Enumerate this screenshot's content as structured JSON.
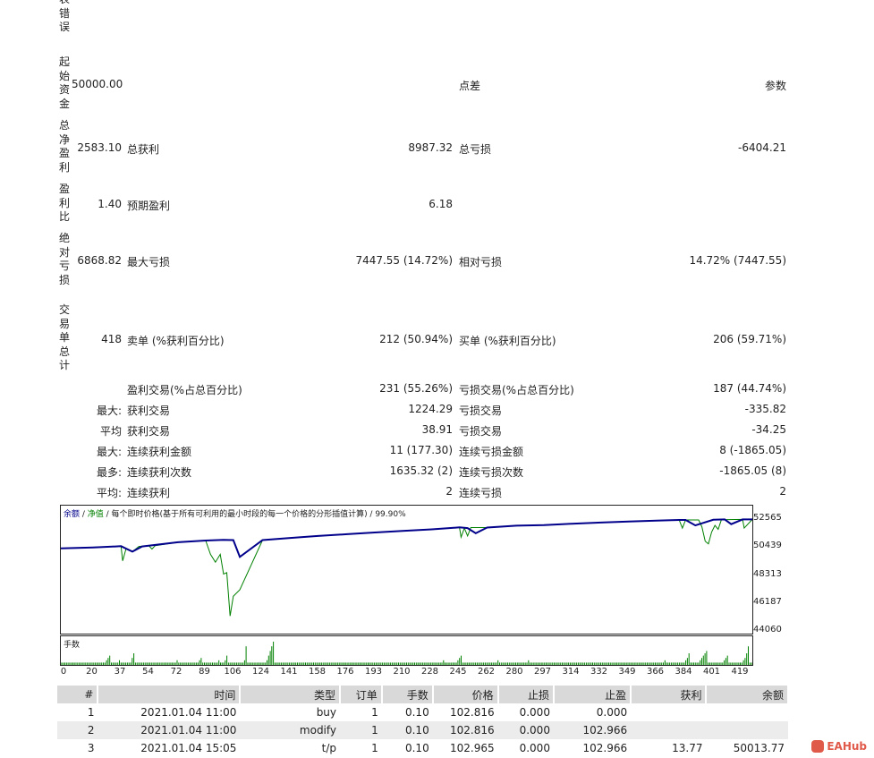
{
  "vlabels": {
    "top": "表错误",
    "initial_deposit": "起始资金",
    "total_net_profit": "总净盈利",
    "profit_factor": "盈利比",
    "abs_drawdown": "绝对亏损",
    "total_trades": "交易单总计"
  },
  "rows": {
    "r1": {
      "v1": "50000.00",
      "l2": "点差",
      "l3": "参数"
    },
    "r2": {
      "v1": "2583.10",
      "l2": "总获利",
      "v2": "8987.32",
      "l3": "总亏损",
      "v3": "-6404.21"
    },
    "r3": {
      "v1": "1.40",
      "l2": "预期盈利",
      "v2": "6.18"
    },
    "r4": {
      "v1": "6868.82",
      "l2": "最大亏损",
      "v2": "7447.55 (14.72%)",
      "l3": "相对亏损",
      "v3": "14.72% (7447.55)"
    },
    "r5": {
      "v1": "418",
      "l2": "卖单 (%获利百分比)",
      "v2": "212 (50.94%)",
      "l3": "买单 (%获利百分比)",
      "v3": "206 (59.71%)"
    },
    "r6": {
      "l2": "盈利交易(%占总百分比)",
      "v2": "231 (55.26%)",
      "l3": "亏损交易(%占总百分比)",
      "v3": "187 (44.74%)"
    },
    "r7": {
      "p": "最大:",
      "l2": "获利交易",
      "v2": "1224.29",
      "l3": "亏损交易",
      "v3": "-335.82"
    },
    "r8": {
      "p": "平均",
      "l2": "获利交易",
      "v2": "38.91",
      "l3": "亏损交易",
      "v3": "-34.25"
    },
    "r9": {
      "p": "最大:",
      "l2": "连续获利金额",
      "v2": "11 (177.30)",
      "l3": "连续亏损金额",
      "v3": "8 (-1865.05)"
    },
    "r10": {
      "p": "最多:",
      "l2": "连续获利次数",
      "v2": "1635.32 (2)",
      "l3": "连续亏损次数",
      "v3": "-1865.05 (8)"
    },
    "r11": {
      "p": "平均:",
      "l2": "连续获利",
      "v2": "2",
      "l3": "连续亏损",
      "v3": "2"
    }
  },
  "chart_data": {
    "type": "line",
    "title_parts": {
      "balance": "余额",
      "sep1": " / ",
      "equity": "净值",
      "rest": " / 每个即时价格(基于所有可利用的最小时段的每一个价格的分形插值计算) / 99.90%"
    },
    "y_ticks": [
      "52565",
      "50439",
      "48313",
      "46187",
      "44060"
    ],
    "ylim": [
      44060,
      53200
    ],
    "x_ticks": [
      "0",
      "20",
      "37",
      "54",
      "72",
      "89",
      "106",
      "124",
      "141",
      "158",
      "176",
      "193",
      "210",
      "228",
      "245",
      "262",
      "280",
      "297",
      "314",
      "332",
      "349",
      "366",
      "384",
      "401",
      "419"
    ],
    "xlim": [
      0,
      425
    ],
    "series": [
      {
        "name": "余额",
        "color": "#00008b",
        "x": [
          0,
          20,
          37,
          44,
          50,
          54,
          72,
          89,
          100,
          106,
          110,
          124,
          141,
          158,
          176,
          193,
          210,
          228,
          245,
          250,
          255,
          262,
          280,
          297,
          314,
          332,
          349,
          366,
          380,
          384,
          390,
          401,
          408,
          412,
          419,
          425
        ],
        "y": [
          50350,
          50420,
          50520,
          50100,
          50500,
          50560,
          50820,
          50950,
          51000,
          50980,
          49700,
          50980,
          51150,
          51300,
          51430,
          51560,
          51680,
          51800,
          51950,
          51900,
          51500,
          51940,
          52080,
          52120,
          52230,
          52320,
          52400,
          52460,
          52520,
          52520,
          52100,
          52530,
          52560,
          52200,
          52560,
          52560
        ]
      },
      {
        "name": "净值",
        "color": "#008000",
        "x": [
          0,
          37,
          38,
          40,
          44,
          48,
          54,
          56,
          58,
          72,
          89,
          92,
          95,
          98,
          100,
          102,
          104,
          106,
          110,
          124,
          141,
          158,
          176,
          193,
          210,
          228,
          245,
          246,
          248,
          250,
          252,
          262,
          280,
          297,
          314,
          332,
          349,
          366,
          380,
          382,
          384,
          392,
          394,
          396,
          398,
          400,
          402,
          404,
          406,
          419,
          420,
          425
        ],
        "y": [
          50350,
          50520,
          49400,
          50300,
          50100,
          50500,
          50560,
          50300,
          50560,
          50820,
          50950,
          49900,
          49300,
          49900,
          48400,
          48500,
          45200,
          46700,
          47200,
          50980,
          51150,
          51300,
          51430,
          51560,
          51680,
          51800,
          51950,
          51200,
          51900,
          51300,
          51940,
          51940,
          52080,
          52120,
          52230,
          52320,
          52400,
          52460,
          52520,
          51900,
          52520,
          52520,
          52000,
          50900,
          50700,
          51600,
          52100,
          51800,
          52530,
          52560,
          51900,
          52560
        ]
      }
    ],
    "volume_label": "手数",
    "volume_color": "#008000",
    "volume": [
      1,
      1,
      1,
      1,
      1,
      1,
      1,
      1,
      1,
      1,
      1,
      1,
      1,
      1,
      1,
      1,
      1,
      1,
      1,
      1,
      1,
      1,
      1,
      1,
      1,
      1,
      1,
      1,
      2,
      3,
      4,
      1,
      1,
      1,
      1,
      1,
      2,
      1,
      1,
      1,
      1,
      1,
      1,
      1,
      3,
      5,
      1,
      1,
      1,
      1,
      1,
      1,
      1,
      1,
      1,
      1,
      1,
      1,
      1,
      1,
      1,
      1,
      1,
      1,
      1,
      1,
      1,
      1,
      1,
      1,
      1,
      1,
      2,
      1,
      1,
      1,
      1,
      1,
      1,
      1,
      1,
      1,
      1,
      1,
      1,
      1,
      2,
      3,
      1,
      1,
      1,
      1,
      1,
      1,
      1,
      1,
      1,
      1,
      2,
      1,
      1,
      1,
      2,
      4,
      1,
      1,
      1,
      1,
      1,
      1,
      1,
      1,
      1,
      1,
      2,
      8,
      1,
      1,
      1,
      1,
      1,
      1,
      1,
      1,
      1,
      1,
      1,
      1,
      2,
      4,
      6,
      8,
      10,
      1,
      1,
      1,
      1,
      1,
      1,
      1,
      1,
      1,
      1,
      1,
      1,
      1,
      1,
      1,
      1,
      1,
      1,
      1,
      1,
      1,
      1,
      1,
      1,
      1,
      1,
      1,
      1,
      1,
      1,
      1,
      1,
      1,
      1,
      1,
      1,
      1,
      1,
      1,
      1,
      1,
      1,
      1,
      1,
      1,
      1,
      1,
      1,
      1,
      1,
      1,
      1,
      1,
      1,
      1,
      1,
      1,
      1,
      1,
      1,
      1,
      1,
      1,
      1,
      1,
      1,
      1,
      1,
      1,
      1,
      1,
      1,
      1,
      1,
      1,
      1,
      1,
      1,
      1,
      1,
      1,
      1,
      1,
      1,
      1,
      1,
      1,
      1,
      1,
      1,
      1,
      1,
      1,
      1,
      1,
      1,
      1,
      1,
      1,
      1,
      1,
      1,
      1,
      1,
      1,
      2,
      1,
      1,
      1,
      1,
      1,
      1,
      1,
      1,
      2,
      3,
      4,
      1,
      1,
      1,
      1,
      1,
      1,
      1,
      1,
      1,
      1,
      1,
      1,
      1,
      1,
      1,
      1,
      1,
      1,
      1,
      1,
      1,
      1,
      2,
      1,
      1,
      1,
      1,
      1,
      1,
      1,
      1,
      1,
      1,
      1,
      1,
      1,
      1,
      1,
      1,
      1,
      1,
      2,
      1,
      1,
      1,
      1,
      1,
      1,
      1,
      1,
      1,
      1,
      1,
      1,
      1,
      1,
      1,
      1,
      1,
      1,
      1,
      1,
      1,
      1,
      1,
      1,
      1,
      1,
      1,
      1,
      1,
      1,
      1,
      1,
      1,
      1,
      1,
      1,
      1,
      1,
      1,
      1,
      1,
      1,
      1,
      1,
      1,
      1,
      1,
      1,
      1,
      1,
      1,
      1,
      1,
      1,
      1,
      1,
      1,
      1,
      1,
      1,
      1,
      1,
      1,
      1,
      1,
      1,
      1,
      1,
      1,
      1,
      1,
      1,
      1,
      1,
      1,
      1,
      1,
      1,
      1,
      1,
      1,
      1,
      1,
      1,
      2,
      1,
      1,
      1,
      1,
      1,
      1,
      1,
      1,
      1,
      1,
      1,
      1,
      2,
      3,
      5,
      1,
      1,
      1,
      1,
      1,
      1,
      2,
      3,
      4,
      5,
      6,
      1,
      1,
      1,
      1,
      1,
      1,
      1,
      1,
      1,
      1,
      2,
      3,
      4,
      1,
      1,
      1,
      1,
      1,
      1,
      1,
      1,
      1,
      2,
      3,
      5,
      8,
      1,
      1
    ]
  },
  "table": {
    "headers": [
      "#",
      "时间",
      "类型",
      "订单",
      "手数",
      "价格",
      "止损",
      "止盈",
      "获利",
      "余额"
    ],
    "rows": [
      [
        "1",
        "2021.01.04 11:00",
        "buy",
        "1",
        "0.10",
        "102.816",
        "0.000",
        "0.000",
        "",
        ""
      ],
      [
        "2",
        "2021.01.04 11:00",
        "modify",
        "1",
        "0.10",
        "102.816",
        "0.000",
        "102.966",
        "",
        ""
      ],
      [
        "3",
        "2021.01.04 15:05",
        "t/p",
        "1",
        "0.10",
        "102.965",
        "0.000",
        "102.966",
        "13.77",
        "50013.77"
      ]
    ]
  },
  "logo": "EAHub"
}
